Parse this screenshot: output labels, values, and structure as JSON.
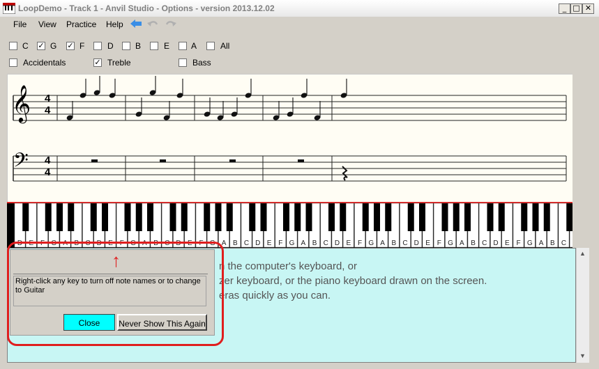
{
  "window": {
    "title": "LoopDemo - Track 1 - Anvil Studio - Options - version 2013.12.02",
    "controls": {
      "minimize": "_",
      "maximize": "□",
      "close": "✕"
    }
  },
  "menu": {
    "file": "File",
    "view": "View",
    "practice": "Practice",
    "help": "Help"
  },
  "notes_row": [
    {
      "label": "C",
      "checked": false
    },
    {
      "label": "G",
      "checked": true
    },
    {
      "label": "F",
      "checked": true
    },
    {
      "label": "D",
      "checked": false
    },
    {
      "label": "B",
      "checked": false
    },
    {
      "label": "E",
      "checked": false
    },
    {
      "label": "A",
      "checked": false
    },
    {
      "label": "All",
      "checked": false
    }
  ],
  "options_row": [
    {
      "label": "Accidentals",
      "checked": false
    },
    {
      "label": "Treble",
      "checked": true
    },
    {
      "label": "Bass",
      "checked": false
    }
  ],
  "score": {
    "time_signature": {
      "top": "4",
      "bottom": "4"
    },
    "treble_clef": "𝄞",
    "bass_clef": "𝄢"
  },
  "piano": {
    "key_labels": [
      "D",
      "E",
      "F",
      "G",
      "A",
      "B",
      "C",
      "D",
      "E",
      "F",
      "G",
      "A",
      "B",
      "C",
      "D",
      "E",
      "F",
      "G",
      "A",
      "B",
      "C",
      "D",
      "E",
      "F",
      "G",
      "A",
      "B",
      "C",
      "D",
      "E",
      "F",
      "G",
      "A",
      "B",
      "C",
      "D",
      "E",
      "F",
      "G",
      "A",
      "B",
      "C",
      "D",
      "E",
      "F",
      "G",
      "A",
      "B",
      "C",
      "D",
      "E",
      "F",
      "G",
      "A"
    ]
  },
  "instructions": {
    "line1": "n the computer's keyboard, or",
    "line2": "zer keyboard, or the piano keyboard drawn on the screen.",
    "line3": "eras quickly as you can."
  },
  "popup": {
    "arrow": "↑",
    "message": "Right-click any key to turn off note names or to change to Guitar",
    "close_label": "Close",
    "never_label": "Never Show This Again"
  },
  "colors": {
    "highlight_button": "#00ffff",
    "annotation_red": "#e01e1e",
    "text_area_bg": "#c8f6f4"
  }
}
